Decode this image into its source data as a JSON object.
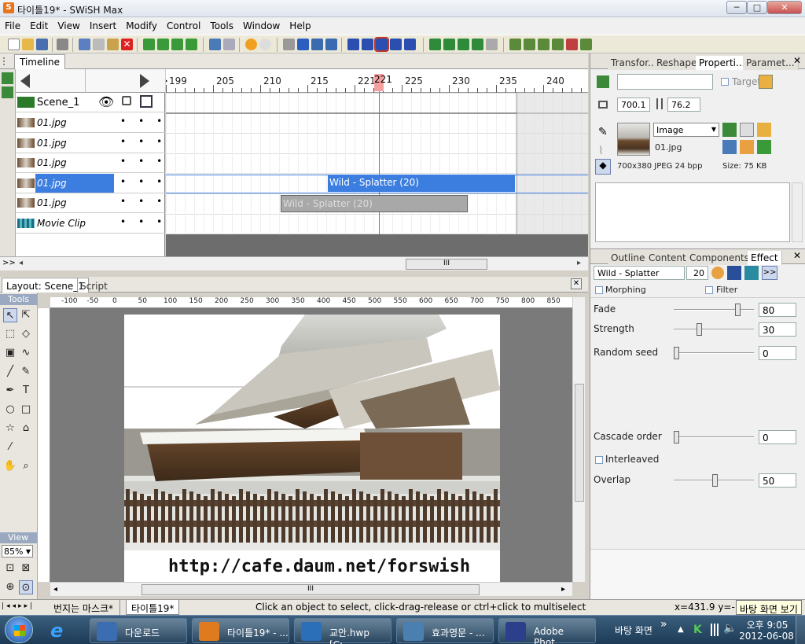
{
  "window": {
    "title": "타이틀19* - SWiSH Max",
    "minimize": "─",
    "maximize": "□",
    "close": "✕"
  },
  "menu": [
    "File",
    "Edit",
    "View",
    "Insert",
    "Modify",
    "Control",
    "Tools",
    "Window",
    "Help"
  ],
  "timeline": {
    "tab": "Timeline",
    "ruler": [
      "199",
      "205",
      "210",
      "215",
      "221",
      "225",
      "230",
      "235",
      "240"
    ],
    "current_frame": "221",
    "scene": "Scene_1",
    "layers": [
      {
        "name": "01.jpg"
      },
      {
        "name": "01.jpg"
      },
      {
        "name": "01.jpg"
      },
      {
        "name": "01.jpg",
        "selected": true
      },
      {
        "name": "01.jpg"
      },
      {
        "name": "Movie Clip"
      }
    ],
    "dots": "•••",
    "effects": [
      {
        "label": "Wild - Splatter (20)",
        "active": true
      },
      {
        "label": "Wild - Splatter (20)",
        "active": false
      }
    ],
    "scroll_grip": "III",
    "expand": ">>"
  },
  "layout": {
    "tabs": [
      "Layout: Scene_1",
      "Script"
    ],
    "close": "✕",
    "tools_label": "Tools",
    "view_label": "View",
    "zoom": "85%",
    "ruler": [
      "-100",
      "-50",
      "0",
      "50",
      "100",
      "150",
      "200",
      "250",
      "300",
      "350",
      "400",
      "450",
      "500",
      "550",
      "600",
      "650",
      "700",
      "750",
      "800",
      "850"
    ],
    "canvas_text": "http://cafe.daum.net/forswish"
  },
  "properties": {
    "tabs": [
      "Transfor...",
      "Reshape",
      "Properti...",
      "Paramet..."
    ],
    "active_tab": "Properti...",
    "name_value": "",
    "target_label": "Target",
    "x": "700.1",
    "y": "76.2",
    "type_select": "Image",
    "filename": "01.jpg",
    "info": "700x380 JPEG 24 bpp",
    "size": "Size: 75 KB"
  },
  "effect_panel": {
    "tabs": [
      "Outline",
      "Content",
      "Components",
      "Effect"
    ],
    "active_tab": "Effect",
    "name": "Wild - Splatter",
    "frames": "20",
    "more": ">>",
    "morphing": "Morphing",
    "filter": "Filter",
    "params": [
      {
        "label": "Fade",
        "value": "80",
        "level": 0.8
      },
      {
        "label": "Strength",
        "value": "30",
        "level": 0.3
      },
      {
        "label": "Random seed",
        "value": "0",
        "level": 0.0
      },
      {
        "label": "Cascade order",
        "value": "0",
        "level": 0.0
      },
      {
        "label": "Overlap",
        "value": "50",
        "level": 0.5
      }
    ],
    "interleaved": "Interleaved"
  },
  "status": {
    "doc_tabs": [
      "번지는 마스크*",
      "타이틀19*"
    ],
    "message": "Click an object to select, click-drag-release or ctrl+click to multiselect",
    "coords": "x=431.9 y=-10",
    "tooltip": "바탕 화면 보기"
  },
  "taskbar": {
    "items": [
      {
        "label": "다운로드",
        "color": "#3b6db0"
      },
      {
        "label": "타이틀19* - ...",
        "color": "#e07a1f"
      },
      {
        "label": "교안.hwp [C:...",
        "color": "#2a6fb8"
      },
      {
        "label": "효과영문 - ...",
        "color": "#4a7fb0"
      },
      {
        "label": "Adobe Phot...",
        "color": "#2b3f8a"
      }
    ],
    "desktop": "바탕 화면",
    "chevron": "»",
    "time": "오후 9:05",
    "date": "2012-06-08"
  }
}
